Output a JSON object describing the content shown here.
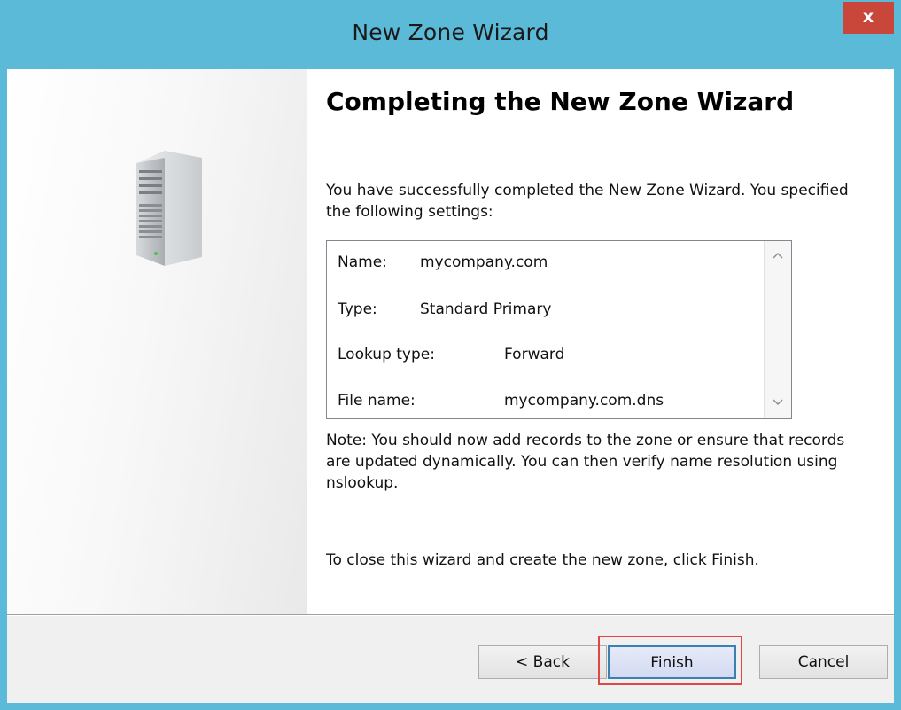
{
  "window": {
    "title": "New Zone Wizard",
    "close_label": "x"
  },
  "wizard": {
    "heading": "Completing the New Zone Wizard",
    "intro": "You have successfully completed the New Zone Wizard. You specified the following settings:",
    "settings": [
      {
        "label": "Name:",
        "value": "mycompany.com"
      },
      {
        "label": "Type:",
        "value": "Standard Primary"
      },
      {
        "label": "Lookup type:",
        "value": "Forward"
      },
      {
        "label": "File name:",
        "value": "mycompany.com.dns"
      }
    ],
    "note": "Note: You should now add records to the zone or ensure that records are updated dynamically. You can then verify name resolution using nslookup.",
    "closing": "To close this wizard and create the new zone, click Finish."
  },
  "buttons": {
    "back": "< Back",
    "finish": "Finish",
    "cancel": "Cancel"
  },
  "icons": {
    "server": "server-icon",
    "scroll_up": "chevron-up-icon",
    "scroll_down": "chevron-down-icon",
    "close": "close-icon"
  },
  "colors": {
    "title_bar": "#5bbad8",
    "close_button": "#c9463b",
    "highlight": "#e04646"
  }
}
